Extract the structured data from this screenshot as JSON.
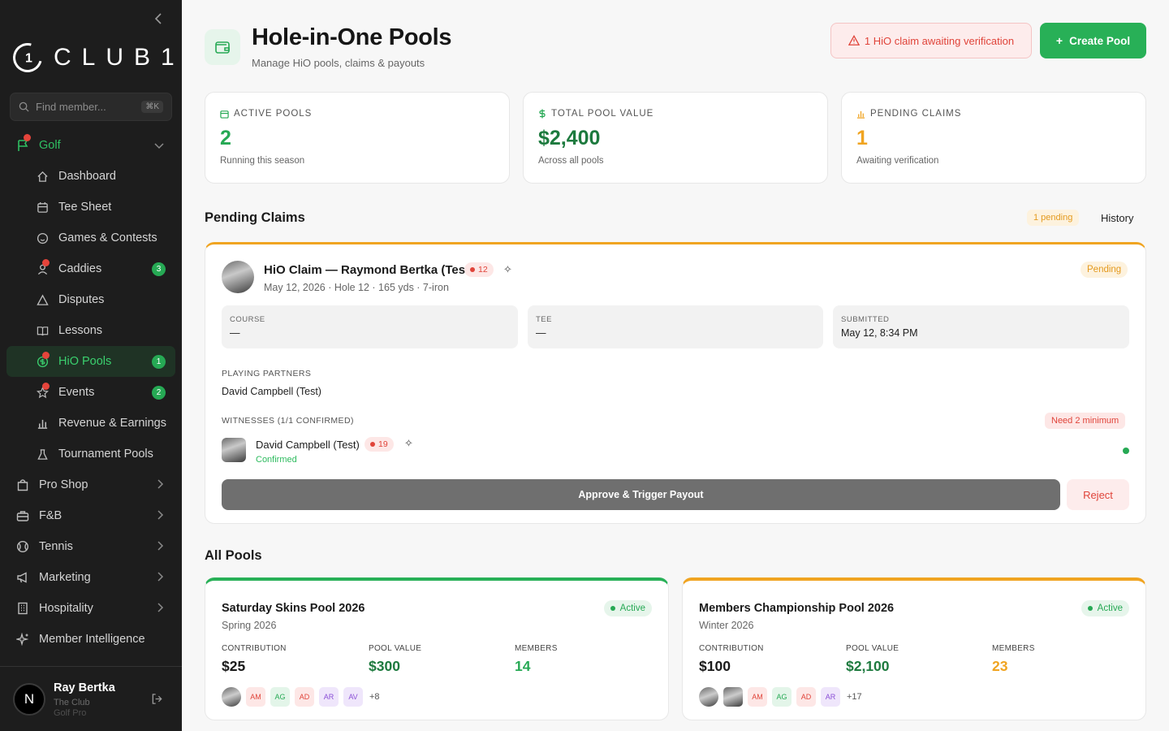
{
  "brand": {
    "logo_mark": "1",
    "logo_text": "CLUB1."
  },
  "search": {
    "placeholder": "Find member...",
    "shortcut": "⌘K"
  },
  "sidebar": {
    "sections": [
      {
        "label": "Golf"
      },
      {
        "label": "Pro Shop"
      },
      {
        "label": "F&B"
      },
      {
        "label": "Tennis"
      },
      {
        "label": "Marketing"
      },
      {
        "label": "Hospitality"
      },
      {
        "label": "Member Intelligence"
      }
    ],
    "golf_items": [
      {
        "label": "Dashboard"
      },
      {
        "label": "Tee Sheet"
      },
      {
        "label": "Games & Contests"
      },
      {
        "label": "Caddies",
        "badge": "3"
      },
      {
        "label": "Disputes"
      },
      {
        "label": "Lessons"
      },
      {
        "label": "HiO Pools",
        "badge": "1"
      },
      {
        "label": "Events",
        "badge": "2"
      },
      {
        "label": "Revenue & Earnings"
      },
      {
        "label": "Tournament Pools"
      }
    ]
  },
  "user": {
    "initial": "N",
    "name": "Ray Bertka",
    "club": "The Club",
    "role": "Golf Pro"
  },
  "header": {
    "title": "Hole-in-One Pools",
    "subtitle": "Manage HiO pools, claims & payouts",
    "alert": "1 HiO claim awaiting verification",
    "create_label": "Create Pool"
  },
  "stats": [
    {
      "label": "ACTIVE POOLS",
      "value": "2",
      "note": "Running this season",
      "color": "#26a954"
    },
    {
      "label": "TOTAL POOL VALUE",
      "value": "$2,400",
      "note": "Across all pools",
      "color": "#1d7a3e"
    },
    {
      "label": "PENDING CLAIMS",
      "value": "1",
      "note": "Awaiting verification",
      "color": "#f0a421"
    }
  ],
  "pending": {
    "title": "Pending Claims",
    "count_label": "1 pending",
    "history_label": "History",
    "claim": {
      "title": "HiO Claim — Raymond Bertka (Test)",
      "pill": "12",
      "meta": "May 12, 2026 · Hole 12 · 165 yds · 7-iron",
      "status": "Pending",
      "course_label": "COURSE",
      "course_value": "—",
      "tee_label": "TEE",
      "tee_value": "—",
      "submitted_label": "SUBMITTED",
      "submitted_value": "May 12, 8:34 PM",
      "partners_label": "PLAYING PARTNERS",
      "partners_value": "David Campbell (Test)",
      "witnesses_label": "WITNESSES (1/1 CONFIRMED)",
      "need_label": "Need 2 minimum",
      "witness_name": "David Campbell (Test)",
      "witness_pill": "19",
      "witness_status": "Confirmed",
      "approve_label": "Approve & Trigger Payout",
      "reject_label": "Reject"
    }
  },
  "all_pools": {
    "title": "All Pools",
    "contribution_label": "CONTRIBUTION",
    "pool_value_label": "POOL VALUE",
    "members_label": "MEMBERS",
    "pools": [
      {
        "name": "Saturday Skins Pool 2026",
        "season": "Spring 2026",
        "status": "Active",
        "contribution": "$25",
        "pool_value": "$300",
        "members": "14",
        "more": "+8",
        "accent": "#28b057",
        "members_color": "#26a954"
      },
      {
        "name": "Members Championship Pool 2026",
        "season": "Winter 2026",
        "status": "Active",
        "contribution": "$100",
        "pool_value": "$2,100",
        "members": "23",
        "more": "+17",
        "accent": "#f0a421",
        "members_color": "#f0a421"
      }
    ],
    "initials_a": [
      "AM",
      "AG",
      "AD",
      "AR",
      "AV"
    ],
    "initials_b": [
      "AM",
      "AG",
      "AD",
      "AR"
    ]
  }
}
